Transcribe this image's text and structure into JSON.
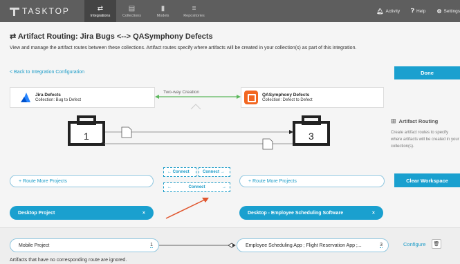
{
  "app": {
    "logo_text": "TASKTOP"
  },
  "nav": {
    "tabs": [
      {
        "label": "Integrations",
        "icon": "⇄"
      },
      {
        "label": "Collections",
        "icon": "▤"
      },
      {
        "label": "Models",
        "icon": "▮"
      },
      {
        "label": "Repositories",
        "icon": "≡"
      }
    ],
    "right": [
      {
        "label": "Activity",
        "icon": "bell-icon"
      },
      {
        "label": "Help",
        "icon": "help-icon"
      },
      {
        "label": "Settings",
        "icon": "gear-icon"
      }
    ]
  },
  "header": {
    "title": "⇄ Artifact Routing: Jira Bugs <--> QASymphony Defects",
    "subtitle": "View and manage the artifact routes between these collections. Artifact routes specify where artifacts will be created in your collection(s) as part of this integration."
  },
  "actions": {
    "back": "< Back to Integration Configuration",
    "done": "Done",
    "clear_workspace": "Clear Workspace"
  },
  "collections": {
    "left": {
      "name": "Jira Defects",
      "sub": "Collection: Bug to Defect"
    },
    "right": {
      "name": "QASymphony Defects",
      "sub": "Collection: Defect to Defect"
    },
    "flow_label": "Two-way Creation"
  },
  "repos": {
    "left_count": "1",
    "right_count": "3"
  },
  "side_panel": {
    "title": "Artifact Routing",
    "text": "Create artifact routes to specify where artifacts will be created in your collection(s)."
  },
  "route_more": {
    "left": "+ Route More Projects",
    "right": "+ Route More Projects"
  },
  "connect": {
    "left_label": "← Connect",
    "right_label": "Connect →",
    "both_label": "Connect",
    "both_left_arrow": "←",
    "both_right_arrow": "→"
  },
  "workspace": {
    "left_project": "Desktop Project",
    "right_project": "Desktop - Employee Scheduling Software",
    "remove": "×"
  },
  "route_row": {
    "left": "Mobile Project",
    "left_count": "1",
    "right": "Employee Scheduling App ; Flight Reservation App ;...",
    "right_count": "3",
    "configure": "Configure"
  },
  "footnote": "Artifacts that have no corresponding route are ignored.",
  "colors": {
    "accent": "#1aa0cf",
    "topbar": "#5e5e5e",
    "green": "#5cb85c",
    "orange": "#f26722",
    "arrow": "#e0552d"
  }
}
